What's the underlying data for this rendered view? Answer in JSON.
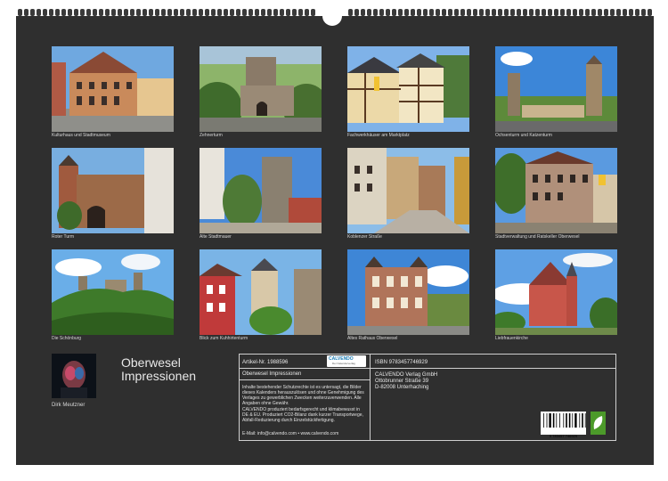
{
  "calendar": {
    "title_line1": "Oberwesel",
    "title_line2": "Impressionen",
    "author": "Dirk Meutzner"
  },
  "photos": [
    {
      "caption": "Kulturhaus und Stadtmuseum"
    },
    {
      "caption": "Zehnerturm"
    },
    {
      "caption": "Fachwerkhäuser am Marktplatz"
    },
    {
      "caption": "Ochsenturm und Katzenturm"
    },
    {
      "caption": "Roter Turm"
    },
    {
      "caption": "Alte Stadtmauer"
    },
    {
      "caption": "Koblenzer Straße"
    },
    {
      "caption": "Stadtverwaltung und Ratskeller Oberwesel"
    },
    {
      "caption": "Die Schönburg"
    },
    {
      "caption": "Blick zum Kuhhirtenturm"
    },
    {
      "caption": "Altes Rathaus Oberwesel"
    },
    {
      "caption": "Liebfrauenkirche"
    }
  ],
  "info": {
    "article": "Artikel-Nr. 1988596",
    "isbn": "ISBN 9783457746929",
    "product_title": "Oberwesel Impressionen",
    "publisher_name": "CALVENDO Verlag GmbH",
    "publisher_street": "Ottobrunner Straße 39",
    "publisher_city": "D-82008 Unterhaching",
    "legal1": "Inhalte bestehender Schutzrechte ist es untersagt, die Bilder dieses Kalenders herauszulösen und ohne Genehmigung des Verlages zu gewerblichen Zwecken weiterzuverwenden. Alle Angaben ohne Gewähr.",
    "legal2": "CALVENDO produziert bedarfsgerecht und klimabewusst in DE & EU. Produziert CO2-Bilanz dank kurzer Transportwege, Abfall-Reduzierung durch Einzelstückfertigung.",
    "contact": "E-Mail: info@calvendo.com • www.calvendo.com",
    "badge_name": "CALVENDO",
    "badge_sub": "Der Kalenderverlag",
    "barcode_number": "9 783457 746929"
  },
  "colors": {
    "sheet": "#2f2f2f",
    "accent_blue": "#1a7db5",
    "leaf_green": "#4c9a2a"
  }
}
